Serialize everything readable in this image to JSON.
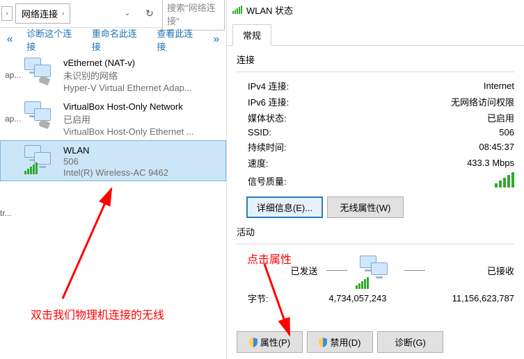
{
  "address_bar": {
    "segment": "网络连接",
    "search_placeholder": "搜索\"网络连接\""
  },
  "command_bar": {
    "diagnose": "诊断这个连接",
    "rename": "重命名此连接",
    "view": "查看此连接"
  },
  "connections": [
    {
      "name": "vEthernet (NAT-v)",
      "status": "未识别的网络",
      "device": "Hyper-V Virtual Ethernet Adap...",
      "cap": "ap..."
    },
    {
      "name": "VirtualBox Host-Only Network",
      "status": "已启用",
      "device": "VirtualBox Host-Only Ethernet ...",
      "cap": "ap..."
    },
    {
      "name": "WLAN",
      "status": "506",
      "device": "Intel(R) Wireless-AC 9462",
      "cap": ""
    }
  ],
  "side_cut": "tr...",
  "dialog": {
    "title": "WLAN 状态",
    "tab_general": "常规",
    "group_connection": "连接",
    "group_activity": "活动",
    "rows": {
      "ipv4_label": "IPv4 连接:",
      "ipv4_value": "Internet",
      "ipv6_label": "IPv6 连接:",
      "ipv6_value": "无网络访问权限",
      "media_label": "媒体状态:",
      "media_value": "已启用",
      "ssid_label": "SSID:",
      "ssid_value": "506",
      "duration_label": "持续时间:",
      "duration_value": "08:45:37",
      "speed_label": "速度:",
      "speed_value": "433.3 Mbps",
      "signal_label": "信号质量:"
    },
    "buttons": {
      "details": "详细信息(E)...",
      "wireless_props": "无线属性(W)",
      "properties": "属性(P)",
      "disable": "禁用(D)",
      "diagnose": "诊断(G)"
    },
    "activity": {
      "sent_label": "已发送",
      "recv_label": "已接收",
      "bytes_label": "字节:",
      "bytes_sent": "4,734,057,243",
      "bytes_recv": "11,156,623,787"
    }
  },
  "annotations": {
    "left": "双击我们物理机连接的无线",
    "right": "点击属性"
  }
}
